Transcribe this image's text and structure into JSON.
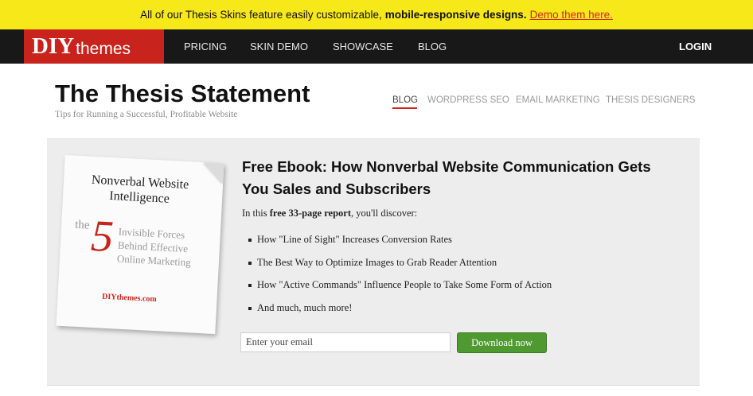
{
  "promo": {
    "text": "All of our Thesis Skins feature easily customizable,",
    "bold": "mobile-responsive designs.",
    "link": "Demo them here."
  },
  "nav": {
    "logo_primary": "DIY",
    "logo_secondary": "themes",
    "items": [
      "PRICING",
      "SKIN DEMO",
      "SHOWCASE",
      "BLOG"
    ],
    "login": "LOGIN"
  },
  "header": {
    "title": "The Thesis Statement",
    "tagline": "Tips for Running a Successful, Profitable Website",
    "subnav": [
      "BLOG",
      "WORDPRESS SEO",
      "EMAIL MARKETING",
      "THESIS DESIGNERS"
    ],
    "active_subnav": "BLOG"
  },
  "ebook_cover": {
    "title": "Nonverbal Website Intelligence",
    "the": "the",
    "number": "5",
    "subtitle": "Invisible Forces Behind Effective Online Marketing",
    "brand": "DIYthemes.com"
  },
  "offer": {
    "heading": "Free Ebook: How Nonverbal Website Communication Gets You Sales and Subscribers",
    "intro_prefix": "In this",
    "intro_bold": "free 33-page report",
    "intro_suffix": ", you'll discover:",
    "bullets": [
      "How \"Line of Sight\" Increases Conversion Rates",
      "The Best Way to Optimize Images to Grab Reader Attention",
      "How \"Active Commands\" Influence People to Take Some Form of Action",
      "And much, much more!"
    ],
    "email_placeholder": "Enter your email",
    "button_label": "Download now"
  },
  "colors": {
    "promo_bg": "#f7e81a",
    "nav_bg": "#181818",
    "brand_red": "#c8231c",
    "button_green": "#4f9a30",
    "panel_bg": "#ededed"
  }
}
